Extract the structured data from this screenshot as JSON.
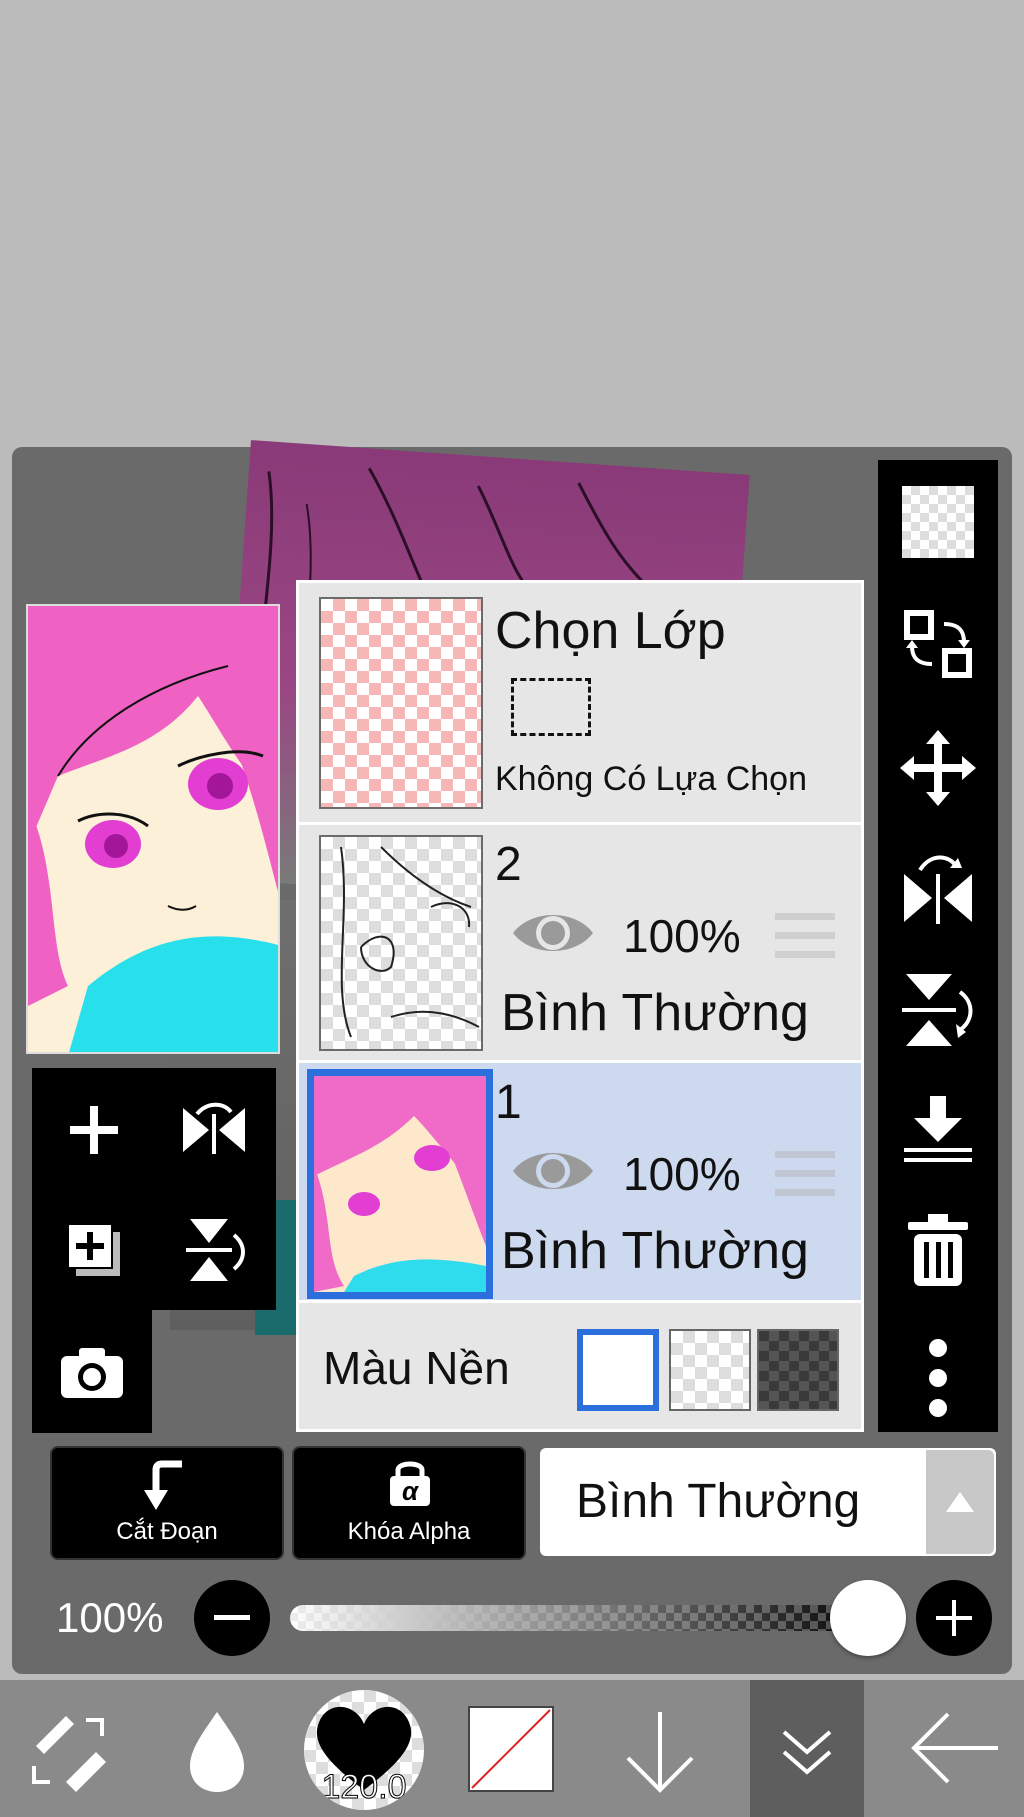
{
  "layer_panel": {
    "selection_layer": {
      "title": "Chọn Lớp",
      "status": "Không Có Lựa Chọn"
    },
    "layers": [
      {
        "name": "2",
        "opacity": "100%",
        "blend": "Bình Thường",
        "selected": false
      },
      {
        "name": "1",
        "opacity": "100%",
        "blend": "Bình Thường",
        "selected": true
      }
    ],
    "background": {
      "label": "Màu Nền",
      "options": [
        "white",
        "transparent-light",
        "transparent-dark"
      ],
      "selected": "white"
    }
  },
  "bottom_controls": {
    "clipping_label": "Cắt Đoạn",
    "alpha_lock_label": "Khóa Alpha",
    "alpha_lock_symbol": "α",
    "blend_mode_value": "Bình Thường",
    "opacity_label": "100%",
    "opacity_value": 1.0
  },
  "bottom_toolbar": {
    "brush_size": "120.0"
  },
  "colors": {
    "selected_layer_bg": "#ccd9ee",
    "selected_border": "#2a6fdc",
    "panel_bg": "#e6e6e6",
    "toolbar_bg": "#000000"
  },
  "icons": {
    "right_toolbar": [
      "checker-icon",
      "swap-icon",
      "move-icon",
      "flip-horizontal-icon",
      "flip-vertical-icon",
      "merge-down-icon",
      "trash-icon",
      "more-icon"
    ],
    "left_tools": [
      "add-layer-icon",
      "flip-layer-horizontal-icon",
      "add-from-canvas-icon",
      "flip-layer-vertical-icon",
      "camera-icon"
    ],
    "bottom_toolbar": [
      "swap-brush-eraser-icon",
      "color-drop-icon",
      "brush-size-heart-icon",
      "color-swatch-icon",
      "arrow-down-icon",
      "chevron-down-double-icon",
      "back-arrow-icon"
    ]
  }
}
